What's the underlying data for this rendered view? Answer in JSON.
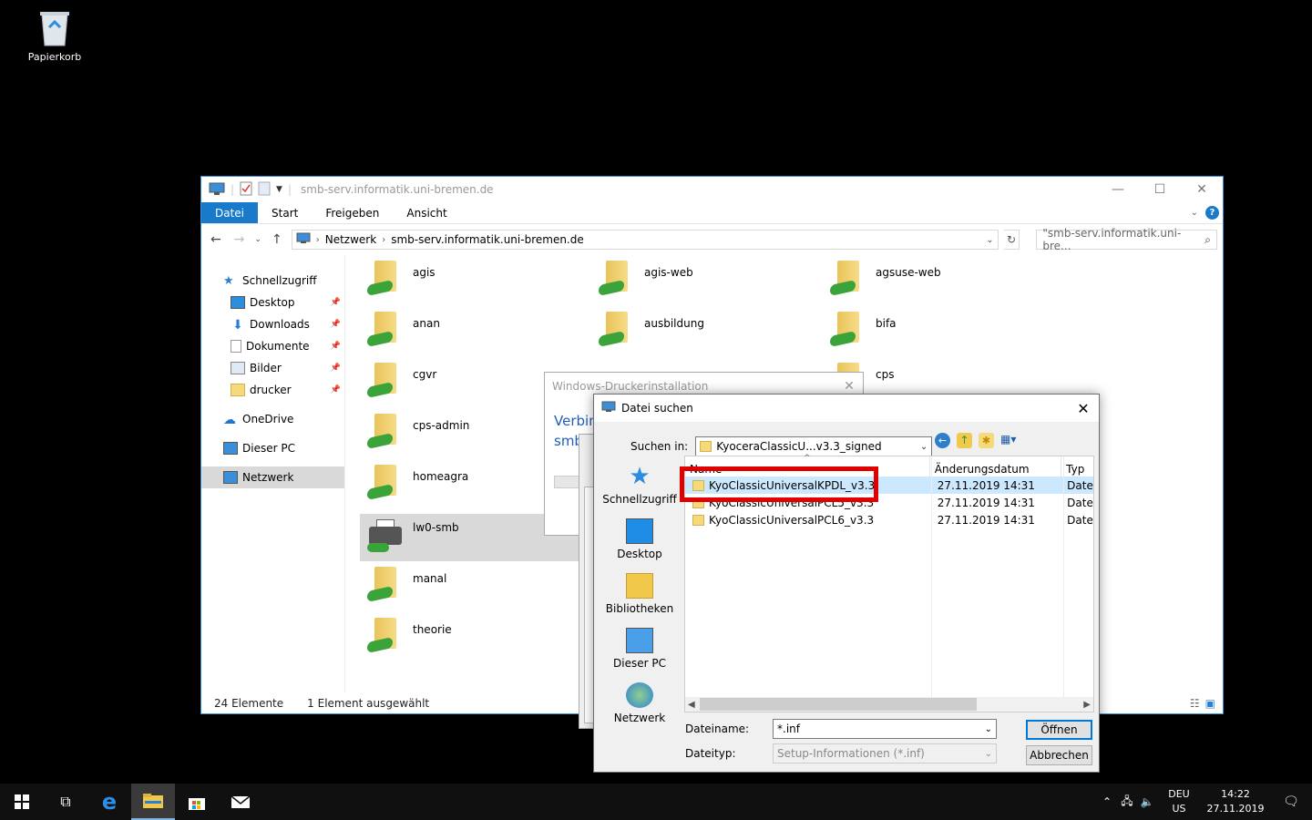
{
  "desktop": {
    "recycle_bin_label": "Papierkorb"
  },
  "explorer": {
    "title": "smb-serv.informatik.uni-bremen.de",
    "ribbon_tabs": [
      "Datei",
      "Start",
      "Freigeben",
      "Ansicht"
    ],
    "address": {
      "segment1": "Netzwerk",
      "segment2": "smb-serv.informatik.uni-bremen.de"
    },
    "search_placeholder": "\"smb-serv.informatik.uni-bre...",
    "nav": {
      "quick_access": "Schnellzugriff",
      "items": [
        "Desktop",
        "Downloads",
        "Dokumente",
        "Bilder",
        "drucker"
      ],
      "onedrive": "OneDrive",
      "this_pc": "Dieser PC",
      "network": "Netzwerk"
    },
    "files": [
      "agis",
      "agis-web",
      "agsuse-web",
      "anan",
      "ausbildung",
      "bifa",
      "cgvr",
      "cps",
      "cps-admin",
      "homeagra",
      "lw0-smb",
      "manal",
      "theorie"
    ],
    "status": {
      "count": "24 Elemente",
      "selected": "1 Element ausgewählt"
    }
  },
  "bg_dialog": {
    "title": "Windows-Druckerinstallation",
    "heading_line1": "Verbin",
    "heading_line2": "smb"
  },
  "file_dialog": {
    "title": "Datei suchen",
    "look_in_label": "Suchen in:",
    "look_in_value": "KyoceraClassicU...v3.3_signed",
    "places": [
      "Schnellzugriff",
      "Desktop",
      "Bibliotheken",
      "Dieser PC",
      "Netzwerk"
    ],
    "columns": {
      "name": "Name",
      "date": "Änderungsdatum",
      "type": "Typ"
    },
    "rows": [
      {
        "name": "KyoClassicUniversalKPDL_v3.3",
        "date": "27.11.2019 14:31",
        "type": "Datei"
      },
      {
        "name": "KyoClassicUniversalPCL5_v3.3",
        "date": "27.11.2019 14:31",
        "type": "Datei"
      },
      {
        "name": "KyoClassicUniversalPCL6_v3.3",
        "date": "27.11.2019 14:31",
        "type": "Datei"
      }
    ],
    "filename_label": "Dateiname:",
    "filename_value": "*.inf",
    "filetype_label": "Dateityp:",
    "filetype_value": "Setup-Informationen (*.inf)",
    "open_button": "Öffnen",
    "cancel_button": "Abbrechen"
  },
  "taskbar": {
    "lang1": "DEU",
    "lang2": "US",
    "time": "14:22",
    "date": "27.11.2019"
  },
  "colors": {
    "accent": "#1979ca",
    "highlight": "#cce8ff",
    "annotation": "#e00000",
    "share_green": "#3aa33a"
  }
}
